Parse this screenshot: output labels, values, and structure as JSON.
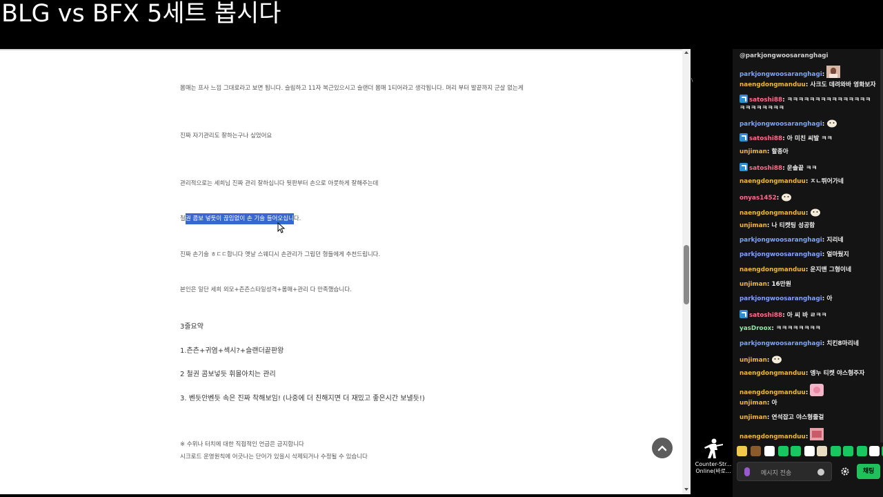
{
  "stream": {
    "title": "BLG vs BFX 5세트 봅시다"
  },
  "document": {
    "paragraphs": [
      {
        "text": "몸매는 프사 느낌 그대로라고 보면 됩니다. 슬림하고 11자 복근있으시고 슬랜더 몸매 1티어라고 생각됩니다. 머리 부터 발끝까지 군살 없는게"
      },
      {
        "text": "진짜 자기관리도 잘하는구나 싶었어요"
      },
      {
        "text": "관리적으로는 세희님 진짜 관리 잘하십니다 뒷판부터 손으로 아룻하게 잘해주는데"
      },
      {
        "prefix": "철",
        "highlighted": "권 콤보 넣듯이 끊임없이 손 기술 들어오십니",
        "suffix": "다."
      },
      {
        "text": "진짜 손기술 ㅎㄷㄷ합니다 옛날 스웨디시 손관리가 그립던 형들에게 추천드립니다."
      },
      {
        "text": "본인은 일단 세희 외모+츤츤스타일성격+몸매+관리 다 만족했습니다."
      },
      {
        "text": "3줄요약"
      },
      {
        "text": "1.츤츤+귀염+섹시?+슬랜더끝판왕"
      },
      {
        "text": "2 철권 콤보넣듯 휘몰아치는 관리"
      },
      {
        "text": "3. 벤듯안벤듯 속은 진짜 착해보임! (나중에 더 친해지면 더 재밌고 좋은시간 보낼듯!)"
      },
      {
        "text": "※ 수위나 터치에 대한 직접적인 언급은 금지합니다"
      },
      {
        "text": "시크로드 운영원칙에 어긋나는 단어가 있을시 삭제되거나 수정될 수 있습니다"
      }
    ]
  },
  "desktop": {
    "icon_label_line1": "Counter-Str...",
    "icon_label_line2": "Online(바로...",
    "edge_mark": "\\"
  },
  "chat": {
    "messages": [
      {
        "nick": "@parkjongwoosaranghagi",
        "nick_color": "#cfcfcf",
        "text": "",
        "badge": false,
        "emote": ""
      },
      {
        "nick": "parkjongwoosaranghagi",
        "nick_color": "#7fa3ff",
        "text": ":",
        "badge": false,
        "emote": "photo"
      },
      {
        "nick": "naengdongmanduu",
        "nick_color": "#f0b73a",
        "text": ": 사크도 데려와바 영화보자",
        "badge": false,
        "emote": ""
      },
      {
        "nick": "satoshi88",
        "nick_color": "#ff6b8b",
        "text": ": ㅋㅋㅋㅋㅋㅋㅋㅋㅋㅋㅋㅋㅋㅋㅋ ㅋㅋㅋㅋㅋㅋㅋㅋ",
        "badge": true,
        "emote": ""
      },
      {
        "nick": "parkjongwoosaranghagi",
        "nick_color": "#7fa3ff",
        "text": ":",
        "badge": false,
        "emote": "face"
      },
      {
        "nick": "satoshi88",
        "nick_color": "#ff6b8b",
        "text": ": 아 미친 씨발 ㅋㅋ",
        "badge": true,
        "emote": ""
      },
      {
        "nick": "unjiman",
        "nick_color": "#f0b73a",
        "text": ": 할종아",
        "badge": false,
        "emote": ""
      },
      {
        "nick": "satoshi88",
        "nick_color": "#ff6b8b",
        "text": ": 운솔끝 ㅋㅋ",
        "badge": true,
        "emote": ""
      },
      {
        "nick": "naengdongmanduu",
        "nick_color": "#f0b73a",
        "text": ": ㅈㄴ뛰어가네",
        "badge": false,
        "emote": ""
      },
      {
        "nick": "onyas1452",
        "nick_color": "#ff6b8b",
        "text": ":",
        "badge": false,
        "emote": "face"
      },
      {
        "nick": "naengdongmanduu",
        "nick_color": "#f0b73a",
        "text": ":",
        "badge": false,
        "emote": "face"
      },
      {
        "nick": "unjiman",
        "nick_color": "#f0b73a",
        "text": ": 나 티켓팅 성공함",
        "badge": false,
        "emote": ""
      },
      {
        "nick": "parkjongwoosaranghagi",
        "nick_color": "#7fa3ff",
        "text": ": 지리네",
        "badge": false,
        "emote": ""
      },
      {
        "nick": "parkjongwoosaranghagi",
        "nick_color": "#7fa3ff",
        "text": ": 얼마뒀지",
        "badge": false,
        "emote": ""
      },
      {
        "nick": "naengdongmanduu",
        "nick_color": "#f0b73a",
        "text": ": 운지맨 그형이네",
        "badge": false,
        "emote": ""
      },
      {
        "nick": "unjiman",
        "nick_color": "#f0b73a",
        "text": ": 16만원",
        "badge": false,
        "emote": ""
      },
      {
        "nick": "parkjongwoosaranghagi",
        "nick_color": "#7fa3ff",
        "text": ": 아",
        "badge": false,
        "emote": ""
      },
      {
        "nick": "satoshi88",
        "nick_color": "#ff6b8b",
        "text": ": 아 씨 바 ㄹㅋㅋ",
        "badge": true,
        "emote": ""
      },
      {
        "nick": "yasDroox",
        "nick_color": "#8de6a6",
        "text": ": ㅋㅋㅋㅋㅋㅋㅋㅋ",
        "badge": false,
        "emote": ""
      },
      {
        "nick": "parkjongwoosaranghagi",
        "nick_color": "#7fa3ff",
        "text": ": 치킨8마리네",
        "badge": false,
        "emote": ""
      },
      {
        "nick": "unjiman",
        "nick_color": "#f0b73a",
        "text": ":",
        "badge": false,
        "emote": "face"
      },
      {
        "nick": "naengdongmanduu",
        "nick_color": "#f0b73a",
        "text": ": 엥누 티켓 야스형주자",
        "badge": false,
        "emote": ""
      },
      {
        "nick": "naengdongmanduu",
        "nick_color": "#f0b73a",
        "text": ":",
        "badge": false,
        "emote": "pink"
      },
      {
        "nick": "unjiman",
        "nick_color": "#f0b73a",
        "text": ": 아",
        "badge": false,
        "emote": ""
      },
      {
        "nick": "unjiman",
        "nick_color": "#f0b73a",
        "text": ": 연석잡고 야스형줄걸",
        "badge": false,
        "emote": ""
      },
      {
        "nick": "naengdongmanduu",
        "nick_color": "#f0b73a",
        "text": ":",
        "badge": false,
        "emote": "photo2"
      }
    ],
    "input_placeholder": "메시지 전송",
    "send_label": "채팅",
    "emote_colors": [
      "#f2c94c",
      "#8b5a2b",
      "#ffffff",
      "#19c760",
      "#19c760",
      "#ffffff",
      "#e8dcc0",
      "#19c760",
      "#19c760",
      "#19c760",
      "#ffffff",
      "#19c760",
      "#19c760"
    ]
  }
}
